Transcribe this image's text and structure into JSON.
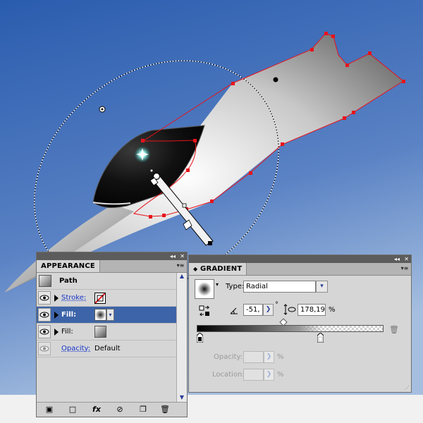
{
  "appearance": {
    "tab": "APPEARANCE",
    "target": "Path",
    "rows": [
      {
        "label": "Stroke:"
      },
      {
        "label": "Fill:"
      },
      {
        "label": "Fill:"
      },
      {
        "label": "Opacity:",
        "value": "Default"
      }
    ]
  },
  "gradient": {
    "tab": "GRADIENT",
    "type_label": "Type:",
    "type_value": "Radial",
    "angle": "-51,",
    "degree": "°",
    "aspect": "178,19",
    "percent": "%",
    "opacity_label": "Opacity:",
    "location_label": "Location:",
    "pct1": "%",
    "pct2": "%"
  },
  "colors": {
    "sky_top": "#2c5fb0",
    "sky_bottom": "#9bb7dc",
    "path_red": "#e8131b",
    "selected_row": "#3d64a8"
  }
}
